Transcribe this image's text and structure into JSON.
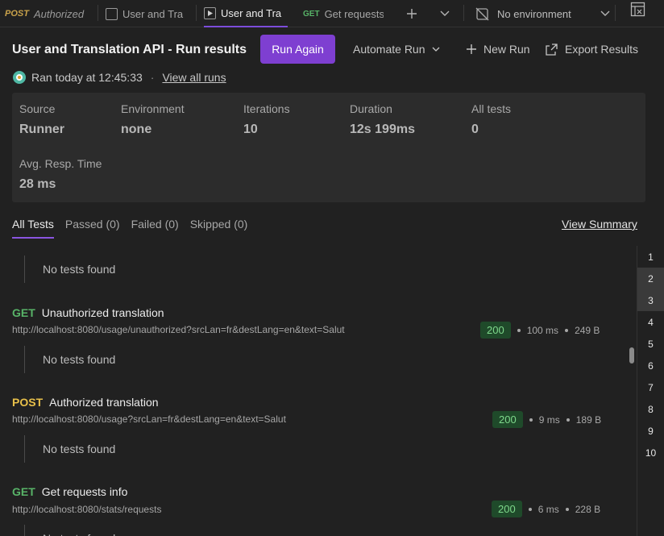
{
  "tabs": [
    {
      "method": "POST",
      "label": "Authorized",
      "method_color": "#c9a24a"
    },
    {
      "label": "User and Tra"
    },
    {
      "label": "User and Tra"
    },
    {
      "method": "GET",
      "label": "Get requests",
      "method_color": "#58b368"
    }
  ],
  "environment": {
    "label": "No environment"
  },
  "header": {
    "title": "User and Translation API - Run results",
    "run_again": "Run Again",
    "automate_run": "Automate Run",
    "new_run": "New Run",
    "export_results": "Export Results"
  },
  "run_info": {
    "ran": "Ran today at 12:45:33",
    "view_all": "View all runs"
  },
  "stats": [
    {
      "label": "Source",
      "value": "Runner"
    },
    {
      "label": "Environment",
      "value": "none"
    },
    {
      "label": "Iterations",
      "value": "10"
    },
    {
      "label": "Duration",
      "value": "12s 199ms"
    },
    {
      "label": "All tests",
      "value": "0"
    },
    {
      "label": "Avg. Resp. Time",
      "value": "28 ms"
    }
  ],
  "filters": {
    "all": "All Tests",
    "passed": "Passed (0)",
    "failed": "Failed (0)",
    "skipped": "Skipped (0)",
    "view_summary": "View Summary"
  },
  "no_tests": "No tests found",
  "requests": [
    {
      "method": "GET",
      "name": "Unauthorized translation",
      "url": "http://localhost:8080/usage/unauthorized?srcLan=fr&destLang=en&text=Salut",
      "status": "200",
      "time": "100 ms",
      "size": "249 B",
      "method_color": "#58b368"
    },
    {
      "method": "POST",
      "name": "Authorized translation",
      "url": "http://localhost:8080/usage?srcLan=fr&destLang=en&text=Salut",
      "status": "200",
      "time": "9 ms",
      "size": "189 B",
      "method_color": "#e8c04a"
    },
    {
      "method": "GET",
      "name": "Get requests info",
      "url": "http://localhost:8080/stats/requests",
      "status": "200",
      "time": "6 ms",
      "size": "228 B",
      "method_color": "#58b368"
    }
  ],
  "iterations": [
    "1",
    "2",
    "3",
    "4",
    "5",
    "6",
    "7",
    "8",
    "9",
    "10"
  ],
  "colors": {
    "accent": "#7e3fd1",
    "status_bg": "#1f4a2a",
    "status_fg": "#7fd98c"
  }
}
